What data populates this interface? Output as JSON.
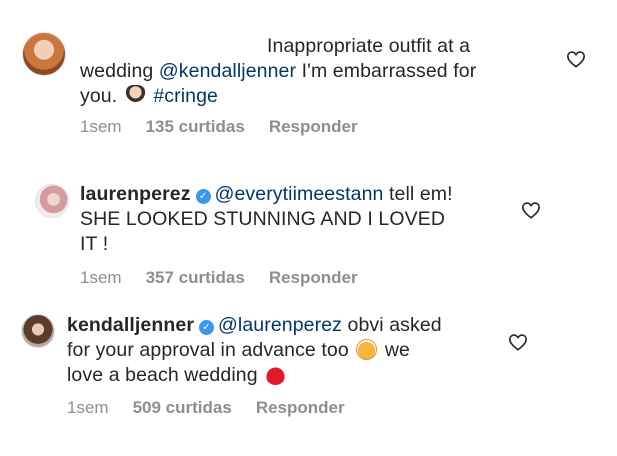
{
  "comments": [
    {
      "lines": [
        "Inappropriate outfit at a",
        "wedding",
        "@kendalljenner",
        "I'm embarrassed for",
        "you.",
        "#cringe"
      ],
      "time": "1sem",
      "likes": "135 curtidas",
      "reply": "Responder"
    },
    {
      "user": "laurenperez",
      "mention": "@everytiimeestann",
      "text1": "tell em!",
      "line2": "SHE LOOKED STUNNING AND I LOVED",
      "line3": "IT !",
      "time": "1sem",
      "likes": "357 curtidas",
      "reply": "Responder"
    },
    {
      "user": "kendalljenner",
      "mention": "@laurenperez",
      "text1": "obvi asked",
      "line2a": "for your approval in advance too",
      "line2b": "we",
      "line3": "love a beach wedding",
      "time": "1sem",
      "likes": "509 curtidas",
      "reply": "Responder"
    }
  ],
  "icons": {
    "verified": "verified-badge-icon",
    "like": "heart-outline-icon"
  },
  "colors": {
    "text": "#262626",
    "mention": "#00376b",
    "meta": "#8e8e8e",
    "verified": "#3897f0"
  }
}
